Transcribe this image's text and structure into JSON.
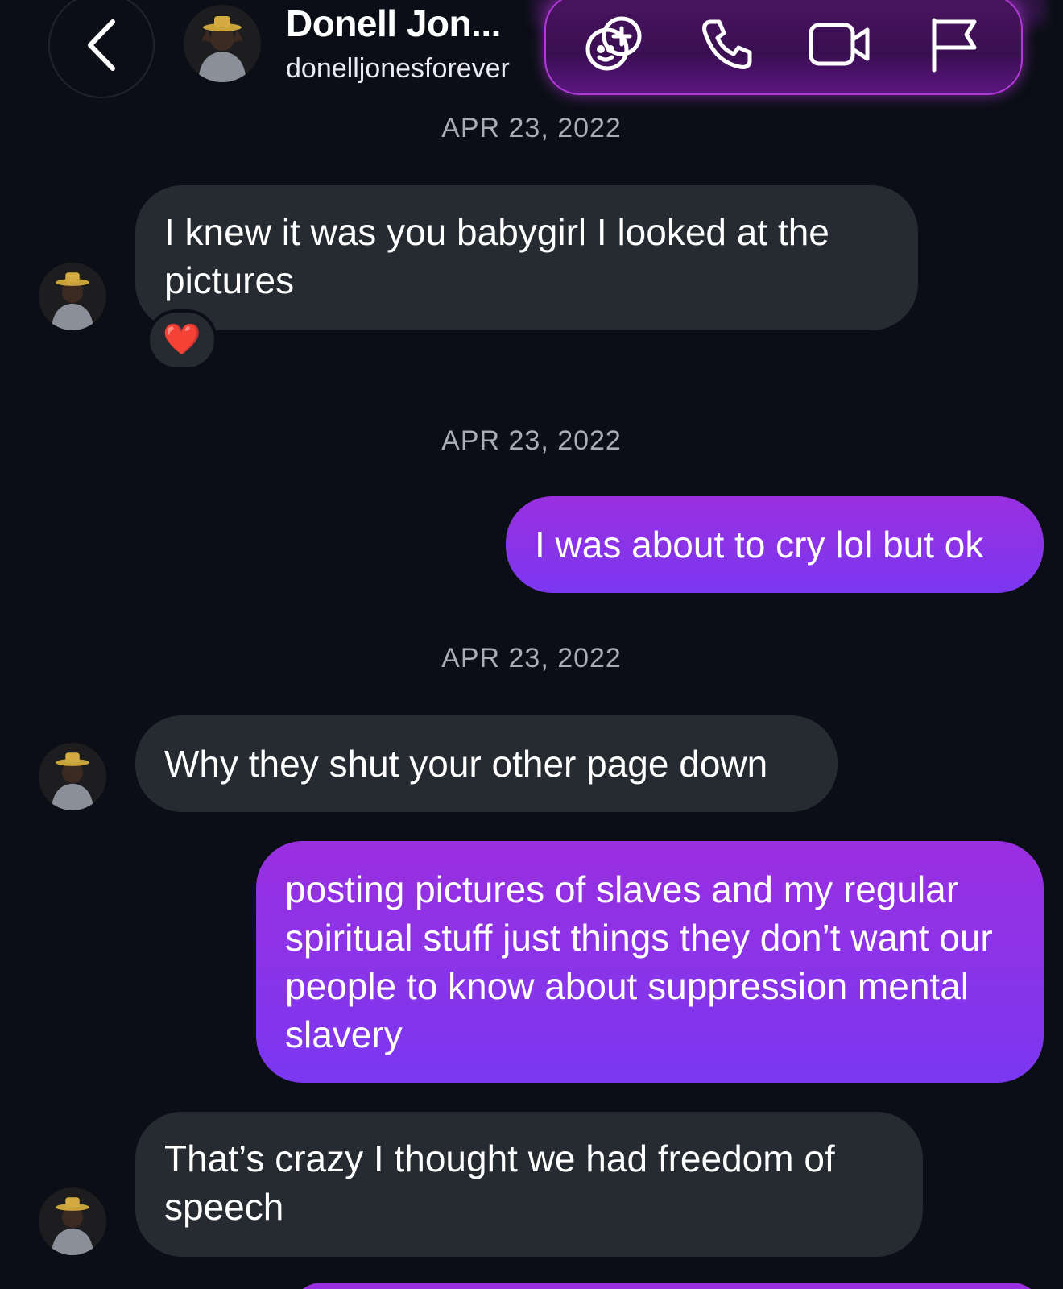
{
  "header": {
    "contact_name": "Donell Jon...",
    "username": "donelljonesforever",
    "back_icon": "chevron-left-icon",
    "actions": [
      "add-effect-icon",
      "phone-icon",
      "video-icon",
      "flag-icon"
    ]
  },
  "colors": {
    "background": "#0b0e16",
    "incoming_bubble": "#262a31",
    "outgoing_bubble_top": "#9a2fe0",
    "outgoing_bubble_bottom": "#7b37f0",
    "accent": "#b23ad9"
  },
  "messages": [
    {
      "timestamp": "APR 23, 2022",
      "direction": "incoming",
      "text": "I knew it was you babygirl I looked  at the pictures",
      "reaction": "❤️"
    },
    {
      "timestamp": "APR 23, 2022",
      "direction": "outgoing",
      "text": "I was about to cry lol but ok"
    },
    {
      "timestamp": "APR 23, 2022",
      "direction": "incoming",
      "text": "Why they shut your other page down"
    },
    {
      "direction": "outgoing",
      "text": "posting pictures of slaves and my regular spiritual stuff just things they don’t want our people to know about suppression mental slavery"
    },
    {
      "direction": "incoming",
      "text": "That’s crazy I thought we had freedom of speech"
    }
  ]
}
